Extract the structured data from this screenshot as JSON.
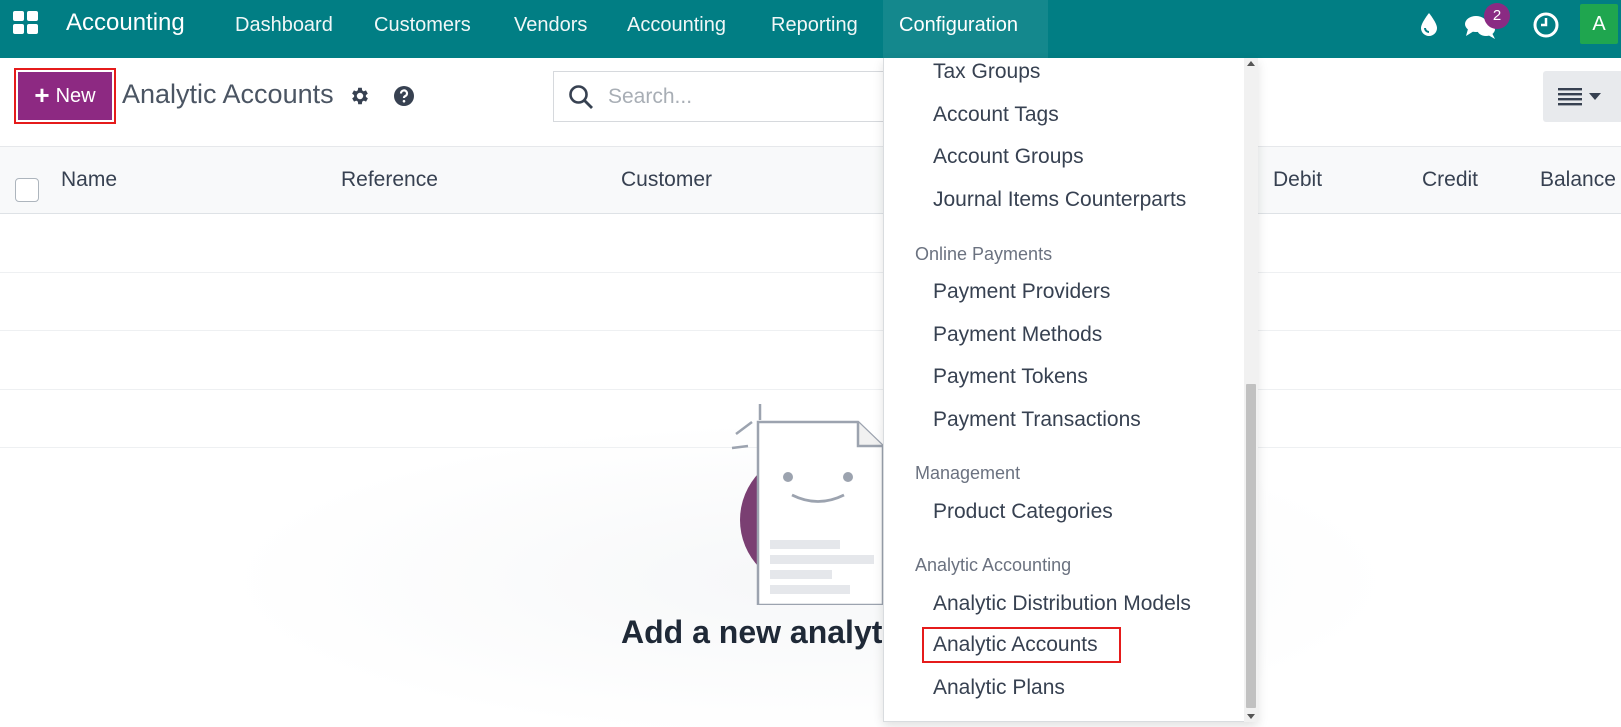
{
  "navbar": {
    "app_title": "Accounting",
    "menu": [
      "Dashboard",
      "Customers",
      "Vendors",
      "Accounting",
      "Reporting",
      "Configuration"
    ],
    "active_menu": "Configuration",
    "messages_badge": "2",
    "avatar_letter": "A",
    "bg_color": "#017e84"
  },
  "control_panel": {
    "new_label": "New",
    "page_title": "Analytic Accounts",
    "search_placeholder": "Search..."
  },
  "table": {
    "columns": [
      "Name",
      "Reference",
      "Customer",
      "Debit",
      "Credit",
      "Balance"
    ]
  },
  "empty_state": {
    "title": "Add a new analytic"
  },
  "dropdown": {
    "items_top": [
      "Tax Groups",
      "Account Tags",
      "Account Groups",
      "Journal Items Counterparts"
    ],
    "section_online_payments": "Online Payments",
    "items_online_payments": [
      "Payment Providers",
      "Payment Methods",
      "Payment Tokens",
      "Payment Transactions"
    ],
    "section_management": "Management",
    "items_management": [
      "Product Categories"
    ],
    "section_analytic": "Analytic Accounting",
    "items_analytic": [
      "Analytic Distribution Models",
      "Analytic Accounts",
      "Analytic Plans"
    ],
    "highlighted_item": "Analytic Accounts"
  }
}
